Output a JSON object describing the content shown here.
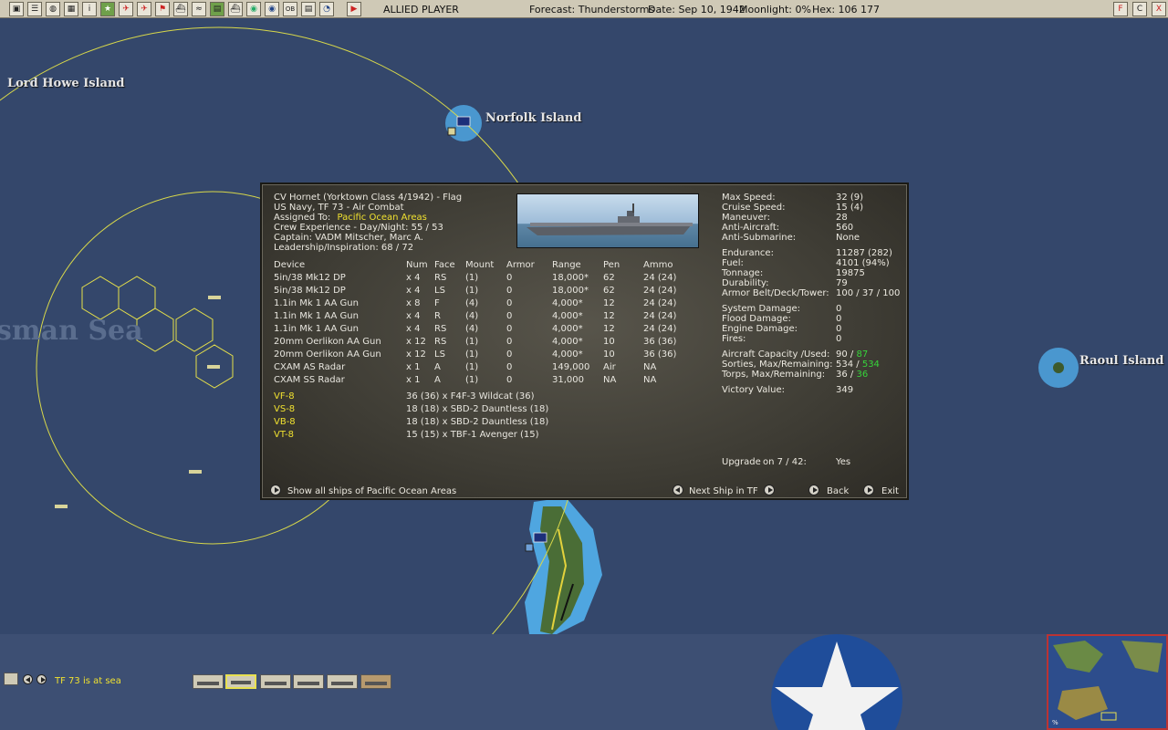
{
  "toolbar": {
    "player": "ALLIED PLAYER",
    "forecast": "Forecast: Thunderstorms",
    "date": "Date: Sep 10, 1942",
    "moonlight": "Moonlight: 0%",
    "hex": "Hex: 106 177",
    "right_buttons": [
      "F",
      "C",
      "X"
    ]
  },
  "map": {
    "places": [
      "Lord Howe Island",
      "Norfolk Island",
      "Raoul Island"
    ],
    "sea_label": "sman Sea"
  },
  "ship": {
    "title": "CV Hornet (Yorktown Class 4/1942) - Flag",
    "navy": "US Navy, TF 73 - Air Combat",
    "assigned_label": "Assigned To:",
    "assigned_value": "Pacific Ocean Areas",
    "crew": "Crew Experience - Day/Night: 55 / 53",
    "captain": "Captain: VADM Mitscher, Marc A.",
    "leadership": "Leadership/Inspiration: 68 / 72"
  },
  "devices": {
    "headers": [
      "Device",
      "Num",
      "Face",
      "Mount",
      "Armor",
      "Range",
      "Pen",
      "Ammo"
    ],
    "rows": [
      [
        "5in/38 Mk12 DP",
        "x 4",
        "RS",
        "(1)",
        "0",
        "18,000*",
        "62",
        "24  (24)"
      ],
      [
        "5in/38 Mk12 DP",
        "x 4",
        "LS",
        "(1)",
        "0",
        "18,000*",
        "62",
        "24  (24)"
      ],
      [
        "1.1in Mk 1 AA Gun",
        "x 8",
        "F",
        "(4)",
        "0",
        "4,000*",
        "12",
        "24  (24)"
      ],
      [
        "1.1in Mk 1 AA Gun",
        "x 4",
        "R",
        "(4)",
        "0",
        "4,000*",
        "12",
        "24  (24)"
      ],
      [
        "1.1in Mk 1 AA Gun",
        "x 4",
        "RS",
        "(4)",
        "0",
        "4,000*",
        "12",
        "24  (24)"
      ],
      [
        "20mm Oerlikon AA Gun",
        "x 12",
        "RS",
        "(1)",
        "0",
        "4,000*",
        "10",
        "36  (36)"
      ],
      [
        "20mm Oerlikon AA Gun",
        "x 12",
        "LS",
        "(1)",
        "0",
        "4,000*",
        "10",
        "36  (36)"
      ],
      [
        "CXAM AS Radar",
        "x 1",
        "A",
        "(1)",
        "0",
        "149,000",
        "Air",
        "NA"
      ],
      [
        "CXAM SS Radar",
        "x 1",
        "A",
        "(1)",
        "0",
        "31,000",
        "NA",
        "NA"
      ]
    ]
  },
  "air_groups": [
    {
      "name": "VF-8",
      "desc": "36 (36) x F4F-3 Wildcat (36)"
    },
    {
      "name": "VS-8",
      "desc": "18 (18) x SBD-2 Dauntless (18)"
    },
    {
      "name": "VB-8",
      "desc": "18 (18) x SBD-2 Dauntless (18)"
    },
    {
      "name": "VT-8",
      "desc": "15 (15) x TBF-1 Avenger (15)"
    }
  ],
  "stats": {
    "max_speed": {
      "label": "Max Speed:",
      "value": "32 (9)"
    },
    "cruise_speed": {
      "label": "Cruise Speed:",
      "value": "15 (4)"
    },
    "maneuver": {
      "label": "Maneuver:",
      "value": "28"
    },
    "anti_aircraft": {
      "label": "Anti-Aircraft:",
      "value": "560"
    },
    "anti_sub": {
      "label": "Anti-Submarine:",
      "value": "None"
    },
    "endurance": {
      "label": "Endurance:",
      "value": "11287 (282)"
    },
    "fuel": {
      "label": "Fuel:",
      "value": "4101 (94%)"
    },
    "tonnage": {
      "label": "Tonnage:",
      "value": "19875"
    },
    "durability": {
      "label": "Durability:",
      "value": "79"
    },
    "armor": {
      "label": "Armor Belt/Deck/Tower:",
      "value": "100 / 37 / 100"
    },
    "system_damage": {
      "label": "System Damage:",
      "value": "0"
    },
    "flood_damage": {
      "label": "Flood Damage:",
      "value": "0"
    },
    "engine_damage": {
      "label": "Engine Damage:",
      "value": "0"
    },
    "fires": {
      "label": "Fires:",
      "value": "0"
    },
    "aircraft_capacity": {
      "label": "Aircraft Capacity /Used:",
      "v1": "90 / ",
      "v2": "87"
    },
    "sorties": {
      "label": "Sorties, Max/Remaining:",
      "v1": "534 / ",
      "v2": "534"
    },
    "torps": {
      "label": "Torps, Max/Remaining:",
      "v1": "36 / ",
      "v2": "36"
    },
    "victory": {
      "label": "Victory Value:",
      "value": "349"
    }
  },
  "upgrade": {
    "label": "Upgrade",
    "on": "on 7 / 42:",
    "value": "Yes"
  },
  "buttons": {
    "show_all": "Show all ships of Pacific Ocean Areas",
    "next_ship": "Next Ship in TF",
    "back": "Back",
    "exit": "Exit"
  },
  "bottom": {
    "status": "TF 73 is at sea",
    "minimap_label": "%"
  }
}
